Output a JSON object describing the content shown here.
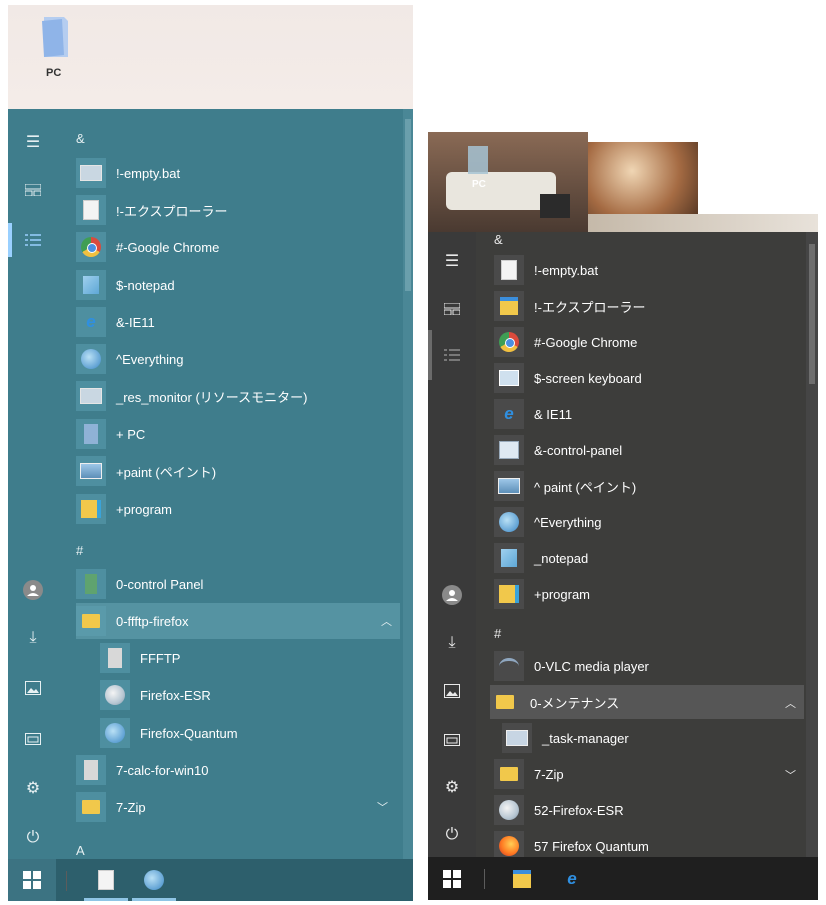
{
  "left": {
    "desktop": {
      "icon_label": "PC"
    },
    "sections": [
      {
        "header": "&",
        "items": [
          {
            "label": "!-empty.bat",
            "icon": "batch-file-icon"
          },
          {
            "label": "!-エクスプローラー",
            "icon": "document-icon"
          },
          {
            "label": "#-Google Chrome",
            "icon": "chrome-icon"
          },
          {
            "label": "$-notepad",
            "icon": "notepad-icon"
          },
          {
            "label": "&-IE11",
            "icon": "internet-explorer-icon"
          },
          {
            "label": "^Everything",
            "icon": "everything-search-icon"
          },
          {
            "label": "_res_monitor (リソースモニター)",
            "icon": "resource-monitor-icon"
          },
          {
            "label": "+ PC",
            "icon": "pc-icon"
          },
          {
            "label": "+paint (ペイント)",
            "icon": "paint-icon"
          },
          {
            "label": "+program",
            "icon": "program-folder-icon"
          }
        ]
      },
      {
        "header": "#",
        "items": [
          {
            "label": "0-control Panel",
            "icon": "control-panel-icon"
          },
          {
            "label": "0-ffftp-firefox",
            "icon": "folder-icon",
            "expanded": true
          },
          {
            "label": "FFFTP",
            "icon": "ffftp-icon",
            "sub": true
          },
          {
            "label": "Firefox-ESR",
            "icon": "firefox-esr-icon",
            "sub": true
          },
          {
            "label": "Firefox-Quantum",
            "icon": "firefox-icon",
            "sub": true
          },
          {
            "label": "7-calc-for-win10",
            "icon": "calculator-icon"
          },
          {
            "label": "7-Zip",
            "icon": "folder-icon",
            "collapsed": true
          }
        ]
      },
      {
        "header": "A",
        "items": []
      }
    ]
  },
  "right": {
    "desktop": {
      "icon_label": "PC"
    },
    "sections": [
      {
        "header": "&",
        "items": [
          {
            "label": "!-empty.bat",
            "icon": "batch-file-icon"
          },
          {
            "label": "!-エクスプローラー",
            "icon": "file-explorer-icon"
          },
          {
            "label": "#-Google Chrome",
            "icon": "chrome-icon"
          },
          {
            "label": "$-screen keyboard",
            "icon": "keyboard-icon"
          },
          {
            "label": "&  IE11",
            "icon": "internet-explorer-icon"
          },
          {
            "label": "&-control-panel",
            "icon": "control-panel-icon"
          },
          {
            "label": "^ paint (ペイント)",
            "icon": "paint-icon"
          },
          {
            "label": "^Everything",
            "icon": "everything-search-icon"
          },
          {
            "label": "_notepad",
            "icon": "notepad-icon"
          },
          {
            "label": "+program",
            "icon": "program-folder-icon"
          }
        ]
      },
      {
        "header": "#",
        "items": [
          {
            "label": "0-VLC media player",
            "icon": "vlc-icon"
          },
          {
            "label": "0-メンテナンス",
            "icon": "folder-icon",
            "expanded": true
          },
          {
            "label": "_task-manager",
            "icon": "task-manager-icon",
            "sub": true
          },
          {
            "label": "7-Zip",
            "icon": "folder-icon",
            "collapsed": true
          },
          {
            "label": "52-Firefox-ESR",
            "icon": "firefox-esr-icon"
          },
          {
            "label": "57 Firefox Quantum",
            "icon": "firefox-icon"
          }
        ]
      }
    ]
  },
  "rail_icons": [
    "hamburger-icon",
    "tiles-icon",
    "list-icon",
    "user-avatar-icon",
    "downloads-icon",
    "pictures-icon",
    "file-explorer-icon",
    "settings-gear-icon",
    "power-icon"
  ],
  "taskbar": {
    "left": [
      "windows-start-icon",
      "document-icon",
      "firefox-esr-icon"
    ],
    "right": [
      "windows-start-icon",
      "file-explorer-icon",
      "internet-explorer-icon"
    ]
  },
  "colors": {
    "left_menu_bg": "#3f7d8c",
    "right_menu_bg": "#3a3a3a",
    "accent": "#9ad0ff"
  }
}
